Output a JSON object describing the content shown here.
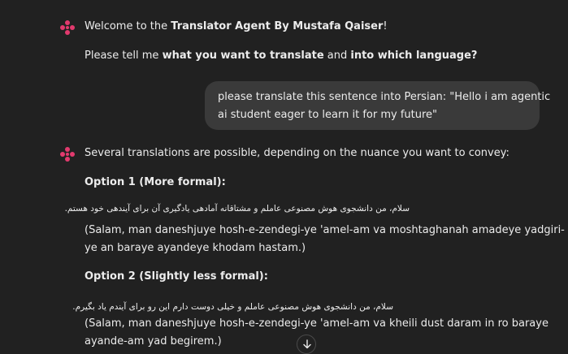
{
  "messages": {
    "welcome": {
      "line1_pre": "Welcome to the ",
      "line1_bold": "Translator Agent By Mustafa Qaiser",
      "line1_post": "!",
      "line2_pre": "Please tell me ",
      "line2_bold1": "what you want to translate",
      "line2_mid": " and ",
      "line2_bold2": "into which language?"
    },
    "user": {
      "line1": "please translate this sentence into Persian: \"Hello i am agentic",
      "line2": "ai student eager to learn it for my future\""
    },
    "reply": {
      "intro": "Several translations are possible, depending on the nuance you want to convey:",
      "option1_title": "Option 1 (More formal):",
      "option1_persian": "سلام، من دانشجوی هوش مصنوعی عاملم و مشتاقانه آمادهی یادگیری آن برای آیندهی خود هستم.",
      "option1_translit_line1": "(Salam, man daneshjuye hosh-e-zendegi-ye 'amel-am va moshtaghanah amadeye yadgiri-",
      "option1_translit_line2": "ye an baraye ayandeye khodam hastam.)",
      "option2_title": "Option 2 (Slightly less formal):",
      "option2_persian": "سلام، من دانشجوی هوش مصنوعی عاملم و خیلی دوست دارم این رو برای آیندم یاد بگیرم.",
      "option2_translit_line1": "(Salam, man daneshjuye hosh-e-zendegi-ye 'amel-am va kheili dust daram in ro baraye",
      "option2_translit_line2": "ayande-am yad begirem.)"
    }
  },
  "icons": {
    "assistant": "assistant-logo-icon",
    "scroll": "arrow-down-icon"
  },
  "colors": {
    "background": "#212121",
    "bubble": "#3a3a3a",
    "text": "#ececec",
    "logo": "#e23a6e"
  }
}
